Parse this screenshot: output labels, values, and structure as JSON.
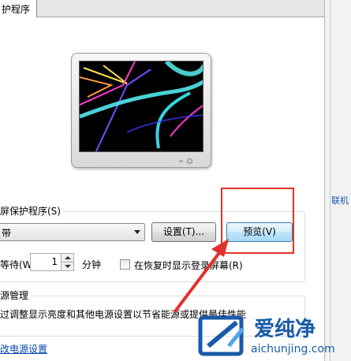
{
  "tab": {
    "label": "护程序"
  },
  "right_panel": {
    "partial_text": "联机"
  },
  "screensaver": {
    "group_title": "屏保护程序(S)",
    "selected": "带",
    "settings_label": "设置(T)...",
    "preview_label": "预览(V)",
    "wait_label": "等待(W):",
    "wait_value": "1",
    "minutes_label": "分钟",
    "resume_label": "在恢复时显示登录屏幕(R)"
  },
  "power": {
    "group_title": "源管理",
    "description": "过调整显示亮度和其他电源设置以节省能源或提供最佳性能",
    "link": "改电源设置"
  },
  "watermark": {
    "title": "爱纯净",
    "url": "aichunjing.com"
  },
  "colors": {
    "annotation": "#e0322b",
    "link": "#0645ad",
    "preview_accent": "#3c7fb1"
  }
}
